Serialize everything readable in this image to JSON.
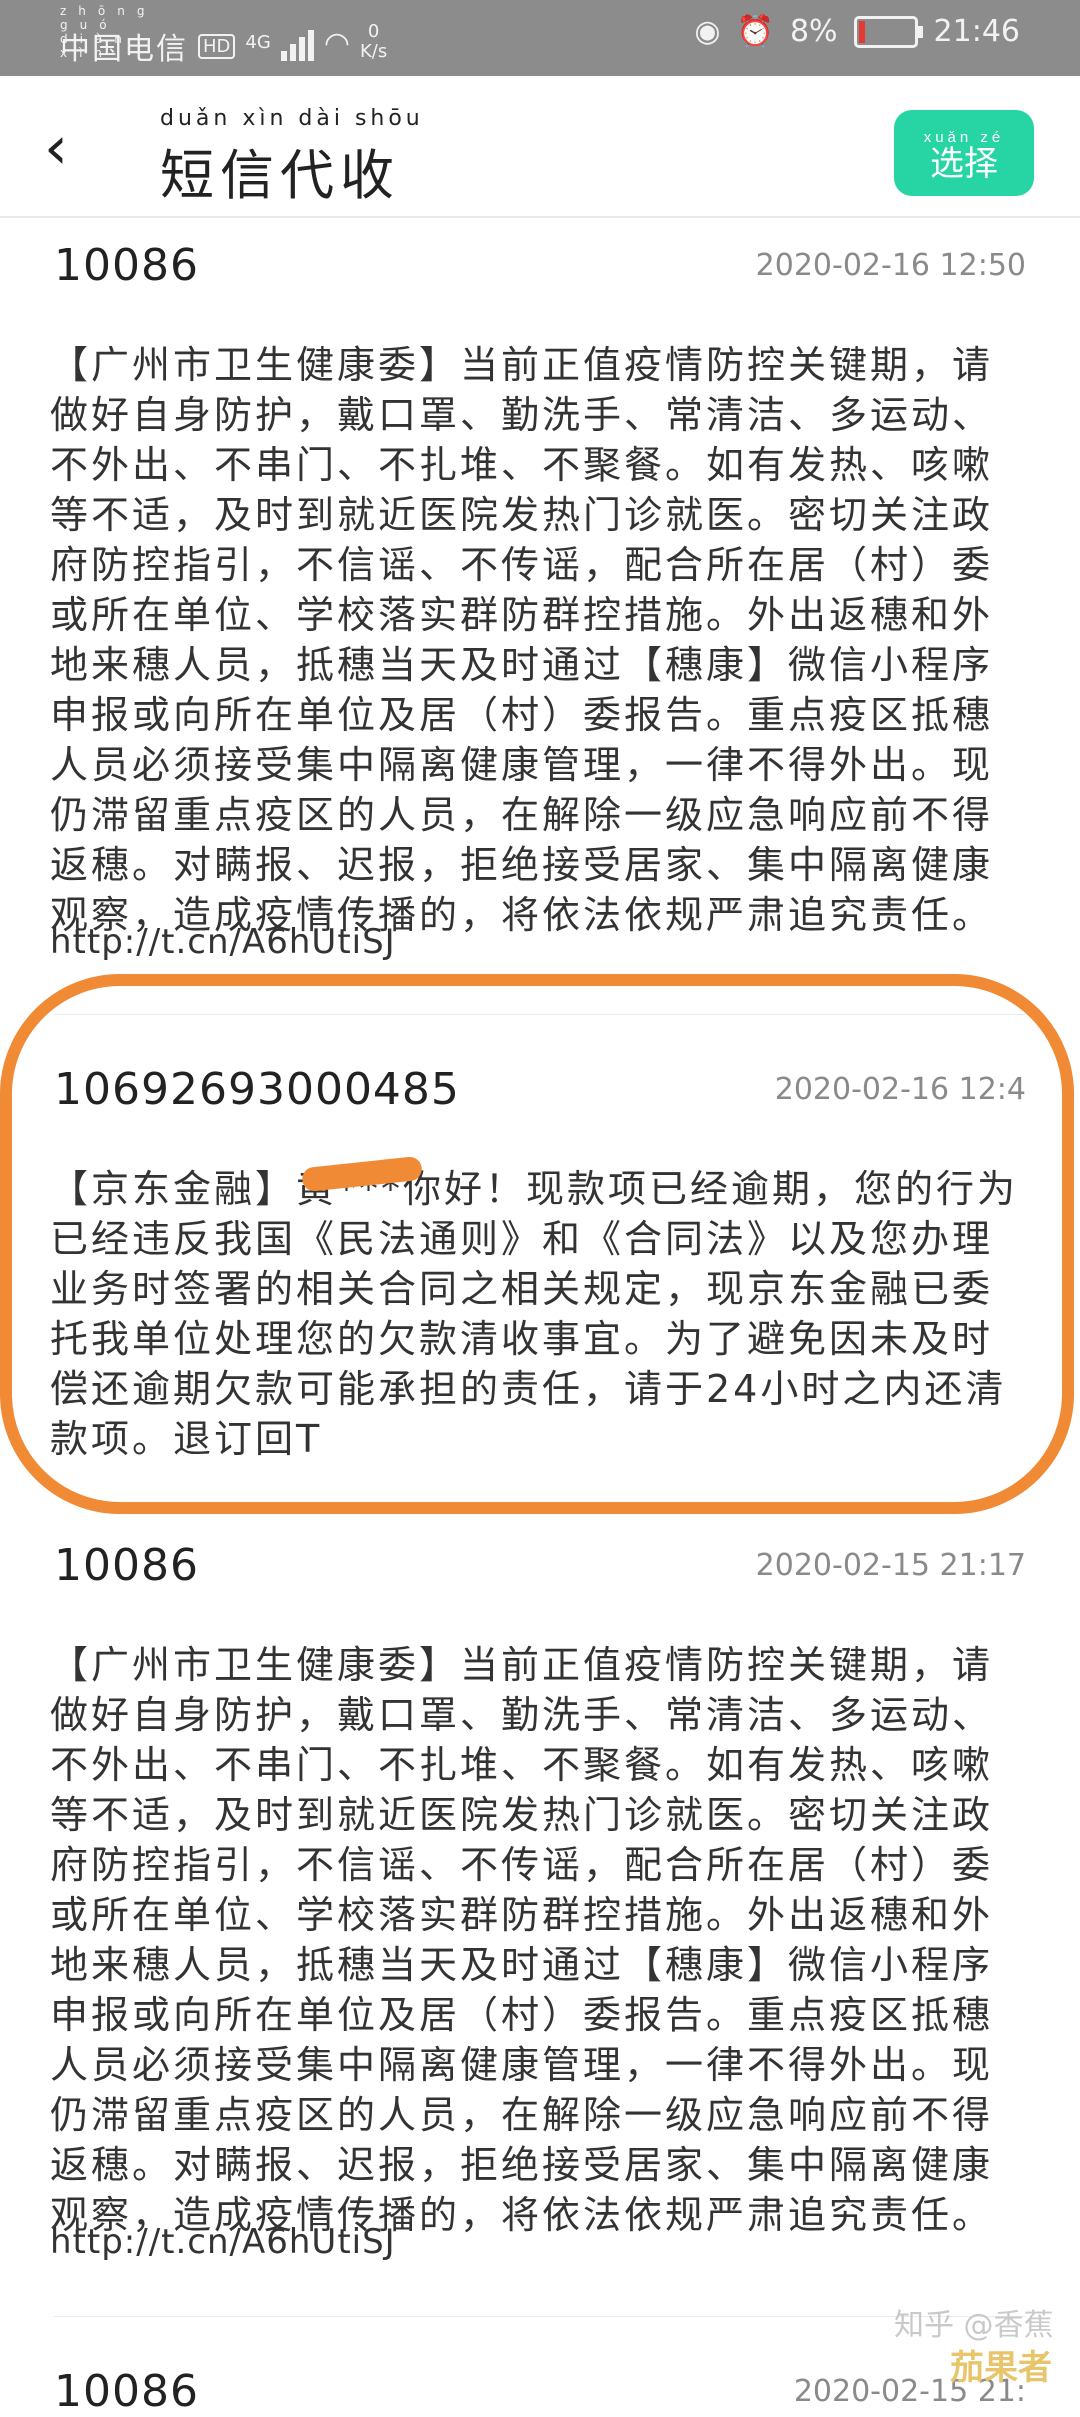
{
  "status_bar": {
    "carrier": "中国电信",
    "carrier_pinyin": "zhōng guó diàn xìn",
    "hd_badge": "HD",
    "network": "4G",
    "speed_value": "0",
    "speed_unit": "K/s",
    "battery": "8%",
    "time": "21:46"
  },
  "header": {
    "back_label": "‹",
    "title": "短信代收",
    "title_pinyin": "duǎn xìn dài shōu",
    "select_button": "选择",
    "select_pinyin": "xuǎn zé",
    "accent_color": "#26d4a4"
  },
  "messages": [
    {
      "sender": "10086",
      "time": "2020-02-16 12:50",
      "body": "【广州市卫生健康委】当前正值疫情防控关键期，请做好自身防护，戴口罩、勤洗手、常清洁、多运动、不外出、不串门、不扎堆、不聚餐。如有发热、咳嗽等不适，及时到就近医院发热门诊就医。密切关注政府防控指引，不信谣、不传谣，配合所在居（村）委或所在单位、学校落实群防群控措施。外出返穗和外地来穗人员，抵穗当天及时通过【穗康】微信小程序申报或向所在单位及居（村）委报告。重点疫区抵穗人员必须接受集中隔离健康管理，一律不得外出。现仍滞留重点疫区的人员，在解除一级应急响应前不得返穗。对瞒报、迟报，拒绝接受居家、集中隔离健康观察，造成疫情传播的，将依法依规严肃追究责任。",
      "link": "http://t.cn/A6hUtiSJ"
    },
    {
      "sender": "10692693000485",
      "time": "2020-02-16 12:4",
      "body": "【京东金融】黄***你好！现款项已经逾期，您的行为已经违反我国《民法通则》和《合同法》以及您办理业务时签署的相关合同之相关规定，现京东金融已委托我单位处理您的欠款清收事宜。为了避免因未及时偿还逾期欠款可能承担的责任，请于24小时之内还清款项。退订回T"
    },
    {
      "sender": "10086",
      "time": "2020-02-15 21:17",
      "body": "【广州市卫生健康委】当前正值疫情防控关键期，请做好自身防护，戴口罩、勤洗手、常清洁、多运动、不外出、不串门、不扎堆、不聚餐。如有发热、咳嗽等不适，及时到就近医院发热门诊就医。密切关注政府防控指引，不信谣、不传谣，配合所在居（村）委或所在单位、学校落实群防群控措施。外出返穗和外地来穗人员，抵穗当天及时通过【穗康】微信小程序申报或向所在单位及居（村）委报告。重点疫区抵穗人员必须接受集中隔离健康管理，一律不得外出。现仍滞留重点疫区的人员，在解除一级应急响应前不得返穗。对瞒报、迟报，拒绝接受居家、集中隔离健康观察，造成疫情传播的，将依法依规严肃追究责任。",
      "link": "http://t.cn/A6hUtiSJ"
    },
    {
      "sender": "10086",
      "time": "2020-02-15 21:"
    }
  ],
  "watermark": "知乎 @香蕉",
  "watermark_site": "茄果者"
}
